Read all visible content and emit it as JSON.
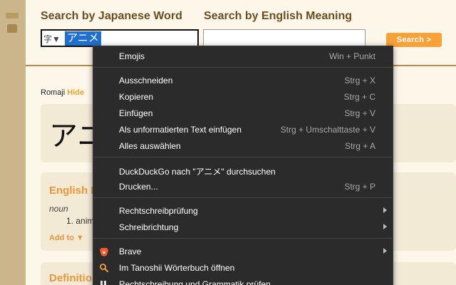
{
  "header": {
    "jp_label": "Search by Japanese Word",
    "en_label": "Search by English Meaning",
    "ime_indicator": "字▼",
    "jp_value": "アニメ",
    "en_value": "",
    "search_button": "Search >"
  },
  "result": {
    "romaji_label": "Romaji",
    "romaji_toggle": "Hide",
    "word": "アニ",
    "def_title": "English M",
    "pos": "noun",
    "item": "1. anim",
    "add_to": "Add to ▼",
    "def2_title": "Definitio"
  },
  "menu": {
    "emojis": {
      "label": "Emojis",
      "shortcut": "Win + Punkt"
    },
    "cut": {
      "label": "Ausschneiden",
      "shortcut": "Strg + X"
    },
    "copy": {
      "label": "Kopieren",
      "shortcut": "Strg + C"
    },
    "paste": {
      "label": "Einfügen",
      "shortcut": "Strg + V"
    },
    "paste_plain": {
      "label": "Als unformatierten Text einfügen",
      "shortcut": "Strg + Umschalttaste + V"
    },
    "select_all": {
      "label": "Alles auswählen",
      "shortcut": "Strg + A"
    },
    "search": {
      "label": "DuckDuckGo nach \"アニメ\" durchsuchen"
    },
    "print": {
      "label": "Drucken...",
      "shortcut": "Strg + P"
    },
    "spellcheck": {
      "label": "Rechtschreibprüfung"
    },
    "direction": {
      "label": "Schreibrichtung"
    },
    "brave": {
      "label": "Brave"
    },
    "tanoshii": {
      "label": "Im Tanoshii Wörterbuch öffnen"
    },
    "grammar": {
      "label": "Rechtschreibung und Grammatik prüfen"
    }
  },
  "colors": {
    "accent": "#f7a238",
    "menu_bg": "#2b2b2b",
    "brown": "#6b4d1f"
  }
}
